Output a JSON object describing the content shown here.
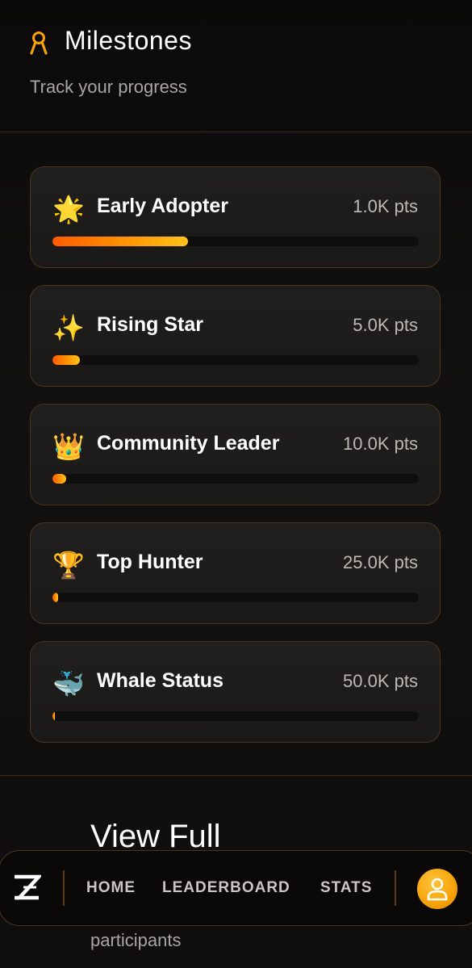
{
  "header": {
    "title": "Milestones",
    "subtitle": "Track your progress",
    "icon": "ribbon-icon",
    "accent": "#f5a308"
  },
  "milestones": [
    {
      "emoji": "🌟",
      "icon": "glowing-star-icon",
      "title": "Early Adopter",
      "points": "1.0K pts",
      "progress": 0.37
    },
    {
      "emoji": "✨",
      "icon": "sparkles-icon",
      "title": "Rising Star",
      "points": "5.0K pts",
      "progress": 0.075
    },
    {
      "emoji": "👑",
      "icon": "crown-icon",
      "title": "Community Leader",
      "points": "10.0K pts",
      "progress": 0.037
    },
    {
      "emoji": "🏆",
      "icon": "trophy-icon",
      "title": "Top Hunter",
      "points": "25.0K pts",
      "progress": 0.015
    },
    {
      "emoji": "🐳",
      "icon": "whale-icon",
      "title": "Whale Status",
      "points": "50.0K pts",
      "progress": 0.007
    }
  ],
  "below": {
    "view_full": "View Full",
    "participants": "participants"
  },
  "nav": {
    "logo": "z-logo-icon",
    "items": [
      "HOME",
      "LEADERBOARD",
      "STATS"
    ],
    "profile_icon": "user-icon",
    "avatar_color": "#f5a308"
  },
  "colors": {
    "background": "#0d0c0b",
    "card_border": "#4a3420",
    "bar_start": "#ff5a00",
    "bar_end": "#ffc21a"
  }
}
